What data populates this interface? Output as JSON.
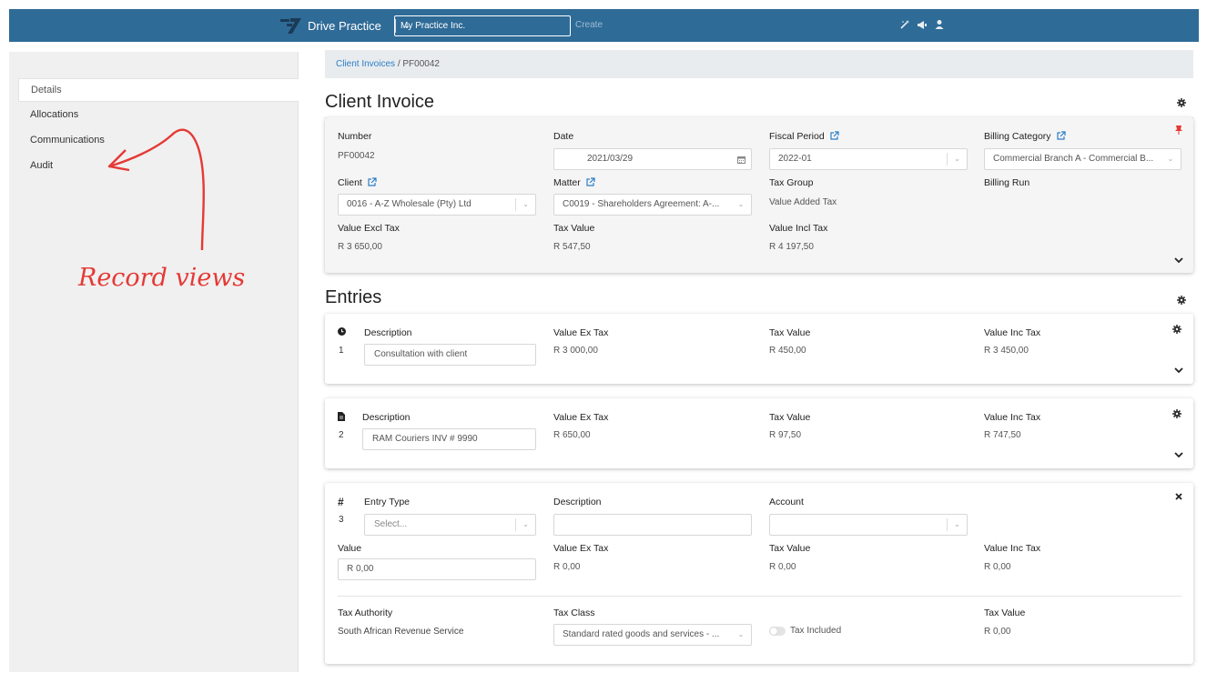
{
  "colors": {
    "topbar": "#2f6b97",
    "link": "#2a7ec7",
    "annotation": "#e53935",
    "pin": "#e53935"
  },
  "topbar": {
    "brand": "Drive Practice",
    "practice_select": "My Practice Inc.",
    "create": "Create",
    "icons": [
      "wand-icon",
      "megaphone-icon",
      "user-icon"
    ]
  },
  "sidebar": {
    "items": [
      {
        "label": "Details"
      },
      {
        "label": "Allocations"
      },
      {
        "label": "Communications"
      },
      {
        "label": "Audit"
      }
    ],
    "annotation": "Record views"
  },
  "breadcrumb": {
    "parent": "Client Invoices",
    "separator": "/",
    "current": "PF00042"
  },
  "invoice": {
    "title": "Client Invoice",
    "number_label": "Number",
    "number": "PF00042",
    "date_label": "Date",
    "date": "2021/03/29",
    "fiscal_label": "Fiscal Period",
    "fiscal": "2022-01",
    "billing_cat_label": "Billing Category",
    "billing_cat": "Commercial Branch A - Commercial B...",
    "client_label": "Client",
    "client": "0016 - A-Z Wholesale (Pty) Ltd",
    "matter_label": "Matter",
    "matter": "C0019 - Shareholders Agreement: A-...",
    "tax_group_label": "Tax Group",
    "tax_group": "Value Added Tax",
    "billing_run_label": "Billing Run",
    "excl_label": "Value Excl Tax",
    "excl": "R 3 650,00",
    "tax_label": "Tax Value",
    "tax": "R 547,50",
    "incl_label": "Value Incl Tax",
    "incl": "R 4 197,50"
  },
  "entries": {
    "title": "Entries",
    "items": [
      {
        "num": "1",
        "desc_label": "Description",
        "desc": "Consultation with client",
        "ex_label": "Value Ex Tax",
        "ex": "R 3 000,00",
        "tax_label": "Tax Value",
        "tax": "R 450,00",
        "inc_label": "Value Inc Tax",
        "inc": "R 3 450,00"
      },
      {
        "num": "2",
        "desc_label": "Description",
        "desc": "RAM Couriers INV # 9990",
        "ex_label": "Value Ex Tax",
        "ex": "R 650,00",
        "tax_label": "Tax Value",
        "tax": "R 97,50",
        "inc_label": "Value Inc Tax",
        "inc": "R 747,50"
      }
    ],
    "new_entry": {
      "hash": "#",
      "num": "3",
      "type_label": "Entry Type",
      "type_placeholder": "Select...",
      "desc_label": "Description",
      "account_label": "Account",
      "value_label": "Value",
      "value": "R 0,00",
      "ex_label": "Value Ex Tax",
      "ex": "R 0,00",
      "tax_label": "Tax Value",
      "tax": "R 0,00",
      "inc_label": "Value Inc Tax",
      "inc": "R 0,00",
      "authority_label": "Tax Authority",
      "authority": "South African Revenue Service",
      "class_label": "Tax Class",
      "class": "Standard rated goods and services - ...",
      "included_label": "Tax Included",
      "tax2_label": "Tax Value",
      "tax2": "R 0,00"
    }
  }
}
